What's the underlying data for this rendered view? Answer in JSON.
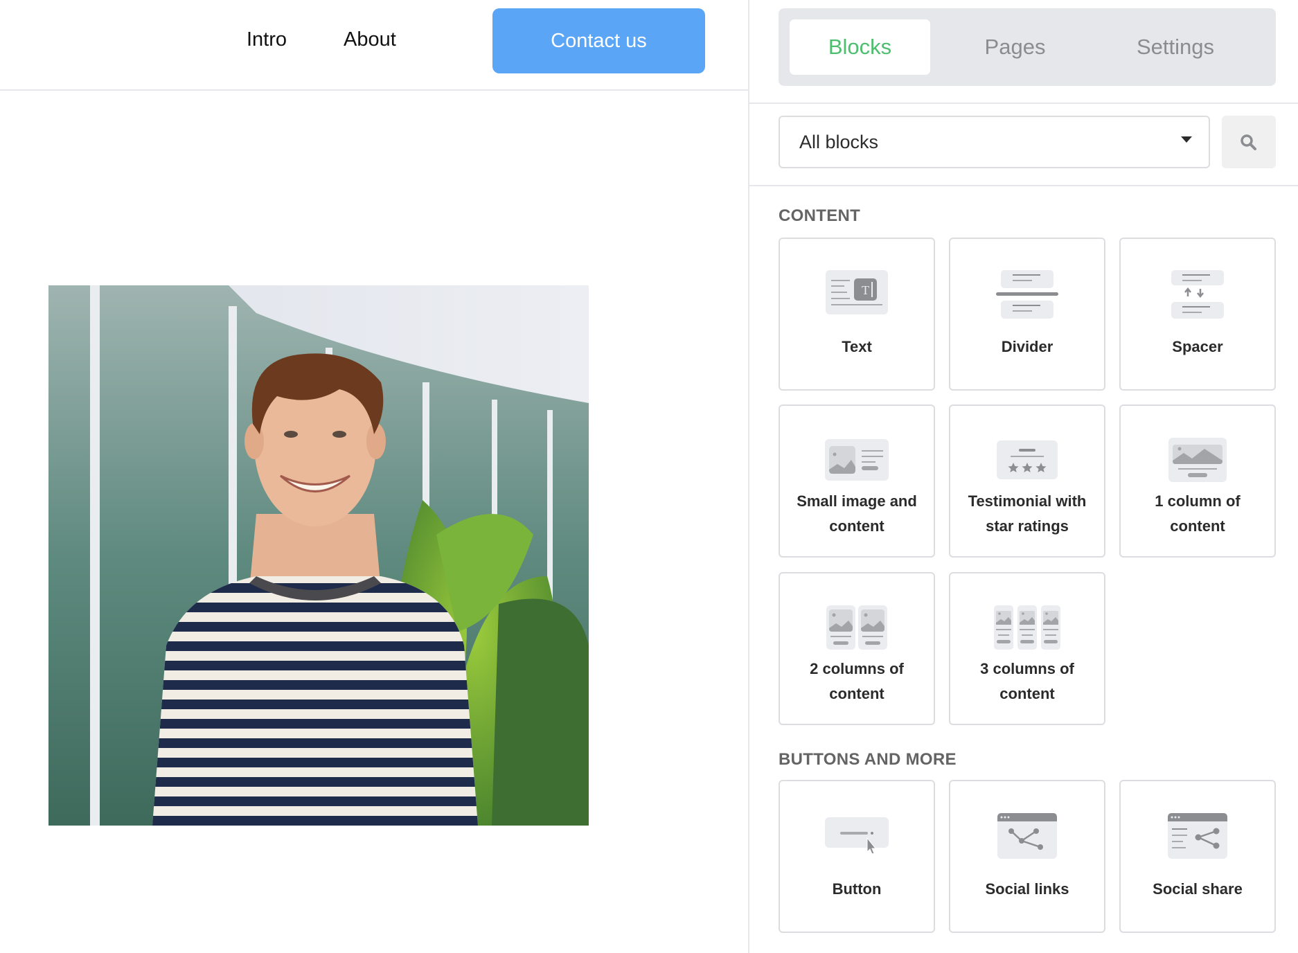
{
  "site": {
    "nav": [
      {
        "label": "Intro"
      },
      {
        "label": "About"
      }
    ],
    "contact_button": {
      "label": "Contact us"
    },
    "photo": {
      "alt": "Smiling man in a navy and white striped shirt standing in front of a glass building with plants"
    }
  },
  "panel": {
    "tabs": [
      {
        "label": "Blocks",
        "active": true
      },
      {
        "label": "Pages",
        "active": false
      },
      {
        "label": "Settings",
        "active": false
      }
    ],
    "filter": {
      "selected": "All blocks"
    },
    "search_icon": "search-icon",
    "sections": [
      {
        "title": "CONTENT",
        "blocks": [
          {
            "label": "Text",
            "icon": "text-block-icon"
          },
          {
            "label": "Divider",
            "icon": "divider-block-icon"
          },
          {
            "label": "Spacer",
            "icon": "spacer-block-icon"
          },
          {
            "label": "Small image and content",
            "label_lines": [
              "Small image and",
              "content"
            ],
            "icon": "small-image-content-icon"
          },
          {
            "label": "Testimonial with star ratings",
            "label_lines": [
              "Testimonial with",
              "star ratings"
            ],
            "icon": "testimonial-stars-icon"
          },
          {
            "label": "1 column of content",
            "label_lines": [
              "1 column of",
              "content"
            ],
            "icon": "one-column-icon"
          },
          {
            "label": "2 columns of content",
            "label_lines": [
              "2 columns of",
              "content"
            ],
            "icon": "two-columns-icon"
          },
          {
            "label": "3 columns of content",
            "label_lines": [
              "3 columns of",
              "content"
            ],
            "icon": "three-columns-icon"
          }
        ]
      },
      {
        "title": "BUTTONS AND MORE",
        "blocks": [
          {
            "label": "Button",
            "icon": "button-block-icon"
          },
          {
            "label": "Social links",
            "icon": "social-links-icon"
          },
          {
            "label": "Social share",
            "icon": "social-share-icon"
          }
        ]
      }
    ]
  },
  "colors": {
    "accent_blue": "#5AA5F6",
    "active_tab_green": "#4DBE6E",
    "inactive_tab_gray": "#8B8C90",
    "icon_bg": "#EBECEF",
    "icon_fg": "#8C8D91"
  }
}
